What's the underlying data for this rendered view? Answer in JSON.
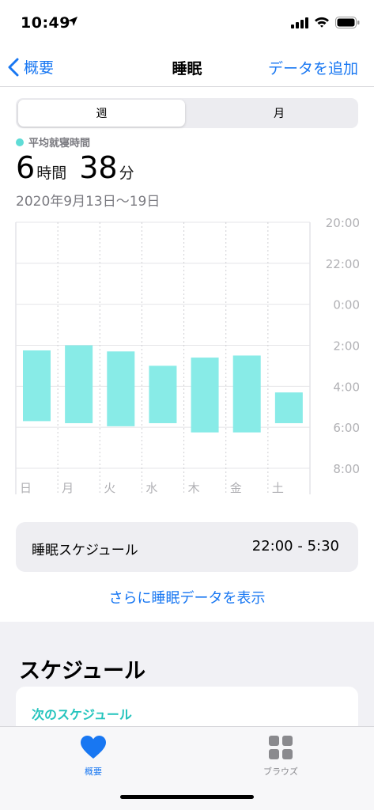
{
  "status_bar": {
    "time": "10:49"
  },
  "nav": {
    "back_label": "概要",
    "title": "睡眠",
    "action_label": "データを追加"
  },
  "segments": {
    "week": "週",
    "month": "月"
  },
  "summary": {
    "legend": "平均就寝時間",
    "hours": "6",
    "hours_unit": "時間",
    "minutes": "38",
    "minutes_unit": "分",
    "date_range": "2020年9月13日〜19日"
  },
  "chart_data": {
    "type": "bar",
    "categories": [
      "日",
      "月",
      "火",
      "水",
      "木",
      "金",
      "土"
    ],
    "y_tick_labels": [
      "20:00",
      "22:00",
      "0:00",
      "2:00",
      "4:00",
      "6:00",
      "8:00"
    ],
    "y_unit": "hours relative to midnight (negative = before midnight)",
    "ylim": [
      -4,
      8
    ],
    "series": [
      {
        "start": [
          -21.75,
          -22.0,
          -21.7,
          -21.0,
          -21.4,
          -21.5,
          4.3
        ],
        "end": [
          5.7,
          5.8,
          5.95,
          5.8,
          6.25,
          6.25,
          5.8
        ]
      }
    ],
    "bar_color": "#88ebe7",
    "grid": true
  },
  "schedule": {
    "label": "睡眠スケジュール",
    "value": "22:00 - 5:30"
  },
  "more_link": "さらに睡眠データを表示",
  "schedule_section": {
    "title": "スケジュール",
    "next_label": "次のスケジュール"
  },
  "tabs": {
    "summary": "概要",
    "browse": "ブラウズ"
  },
  "colors": {
    "accent": "#1877f2",
    "sleep": "#88ebe7",
    "teal_text": "#24c4bd"
  }
}
